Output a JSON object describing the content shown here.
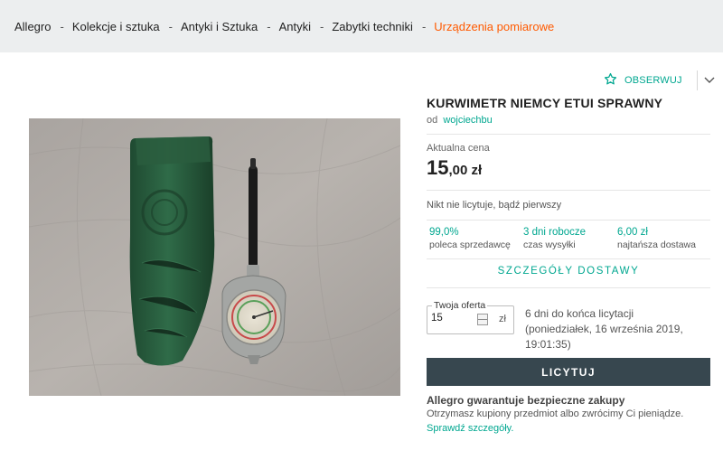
{
  "breadcrumb": {
    "items": [
      "Allegro",
      "Kolekcje i sztuka",
      "Antyki i Sztuka",
      "Antyki",
      "Zabytki techniki",
      "Urządzenia pomiarowe"
    ],
    "separator": "-"
  },
  "watch": {
    "label": "OBSERWUJ",
    "icon": "star-outline-icon",
    "menu_icon": "chevron-down-icon"
  },
  "product": {
    "title": "KURWIMETR NIEMCY ETUI SPRAWNY",
    "seller_prefix": "od",
    "seller_name": "wojciechbu",
    "image_icon": "photo-curvimeter-in-green-case"
  },
  "price": {
    "label": "Aktualna cena",
    "main": "15",
    "decimals": ",00 zł"
  },
  "bids": {
    "status": "Nikt nie licytuje, bądź pierwszy"
  },
  "stats": [
    {
      "value": "99,0%",
      "label": "poleca sprzedawcę"
    },
    {
      "value": "3 dni robocze",
      "label": "czas wysyłki"
    },
    {
      "value": "6,00 zł",
      "label": "najtańsza dostawa"
    }
  ],
  "delivery": {
    "link": "SZCZEGÓŁY DOSTAWY"
  },
  "offer": {
    "legend": "Twoja oferta",
    "value": "15",
    "currency": "zł",
    "ends_line1": "6 dni do końca licytacji",
    "ends_line2": "(poniedziałek, 16 września 2019,",
    "ends_line3": "19:01:35)"
  },
  "bid_button": {
    "label": "LICYTUJ"
  },
  "guarantee": {
    "heading": "Allegro gwarantuje bezpieczne zakupy",
    "text": "Otrzymasz kupiony przedmiot albo zwrócimy Ci pieniądze.",
    "link": "Sprawdź szczegóły."
  },
  "colors": {
    "accent": "#00a790",
    "current_crumb": "#ff5a00",
    "button": "#37474f",
    "breadcrumb_bg": "#eceeef"
  }
}
